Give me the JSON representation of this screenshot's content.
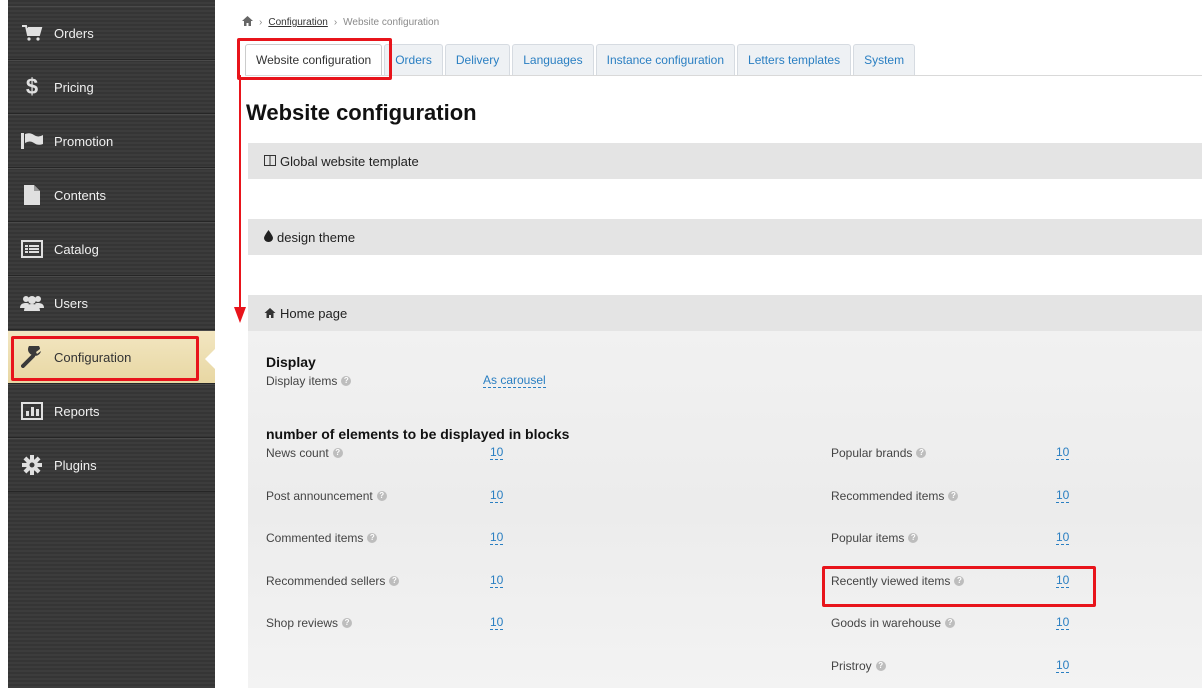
{
  "sidebar": {
    "items": [
      {
        "label": "Orders",
        "icon": "cart-icon"
      },
      {
        "label": "Pricing",
        "icon": "dollar-icon"
      },
      {
        "label": "Promotion",
        "icon": "flag-icon"
      },
      {
        "label": "Contents",
        "icon": "document-icon"
      },
      {
        "label": "Catalog",
        "icon": "list-icon"
      },
      {
        "label": "Users",
        "icon": "users-icon"
      },
      {
        "label": "Configuration",
        "icon": "wrench-icon",
        "active": true
      },
      {
        "label": "Reports",
        "icon": "bar-chart-icon"
      },
      {
        "label": "Plugins",
        "icon": "gear-icon"
      }
    ]
  },
  "breadcrumb": {
    "home_icon": "home-icon",
    "link": "Configuration",
    "current": "Website configuration"
  },
  "tabs": [
    {
      "label": "Website configuration",
      "active": true
    },
    {
      "label": "Orders"
    },
    {
      "label": "Delivery"
    },
    {
      "label": "Languages"
    },
    {
      "label": "Instance configuration"
    },
    {
      "label": "Letters templates"
    },
    {
      "label": "System"
    }
  ],
  "page_title": "Website configuration",
  "sections": {
    "global": "Global website template",
    "theme": "design theme",
    "home": "Home page"
  },
  "display": {
    "title": "Display",
    "items_label": "Display items",
    "items_value": "As carousel"
  },
  "blocks": {
    "title": "number of elements to be displayed in blocks",
    "left": [
      {
        "label": "News count",
        "value": "10"
      },
      {
        "label": "Post announcement",
        "value": "10"
      },
      {
        "label": "Commented items",
        "value": "10"
      },
      {
        "label": "Recommended sellers",
        "value": "10"
      },
      {
        "label": "Shop reviews",
        "value": "10"
      }
    ],
    "right": [
      {
        "label": "Popular brands",
        "value": "10"
      },
      {
        "label": "Recommended items",
        "value": "10"
      },
      {
        "label": "Popular items",
        "value": "10"
      },
      {
        "label": "Recently viewed items",
        "value": "10"
      },
      {
        "label": "Goods in warehouse",
        "value": "10"
      },
      {
        "label": "Pristroy",
        "value": "10"
      }
    ]
  },
  "colors": {
    "accent": "#2a7fc2",
    "highlight": "#e8141b",
    "active_menu": "#f2e6c1"
  }
}
